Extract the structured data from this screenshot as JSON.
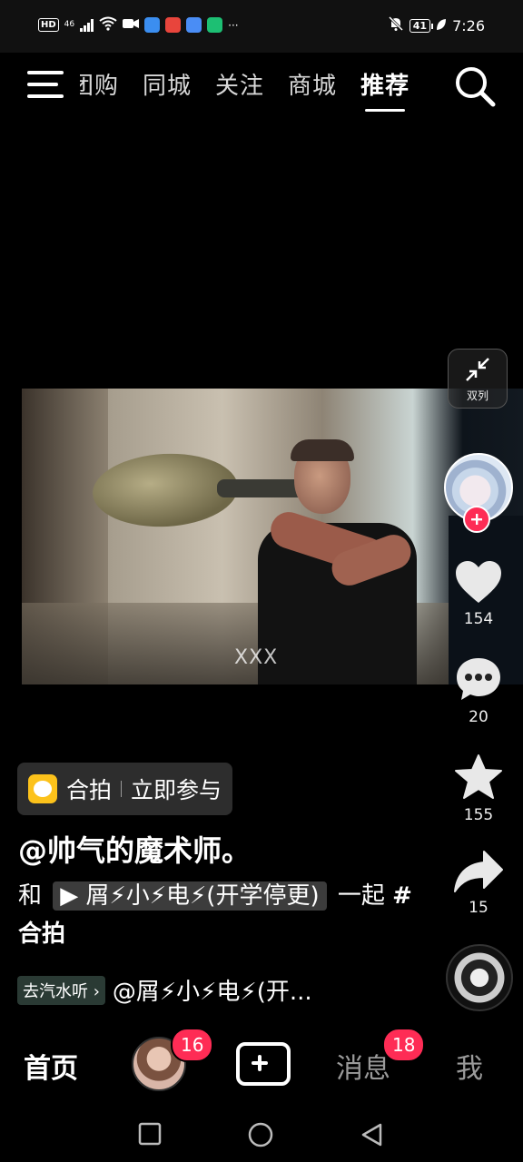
{
  "status_bar": {
    "hd": "HD",
    "network": "46",
    "time": "7:26",
    "battery": "41"
  },
  "top_nav": {
    "tabs": [
      {
        "label": "团购"
      },
      {
        "label": "同城"
      },
      {
        "label": "关注"
      },
      {
        "label": "商城"
      },
      {
        "label": "推荐"
      }
    ],
    "active_tab": "推荐"
  },
  "video": {
    "watermark": "XXX"
  },
  "sidebar": {
    "double_column_label": "双列",
    "likes": "154",
    "comments": "20",
    "favorites": "155",
    "shares": "15"
  },
  "content": {
    "duet_label": "合拍",
    "duet_action": "立即参与",
    "author": "@帅气的魔术师。",
    "desc_prefix": "和",
    "mention": "▶ 屑⚡小⚡电⚡(开学停更)",
    "desc_middle": "一起",
    "hashtag": "#合拍",
    "listen_chip": "去汽水听",
    "music_text": "@屑⚡小⚡电⚡(开..."
  },
  "bottom_nav": {
    "home": "首页",
    "friend_badge": "16",
    "messages": "消息",
    "messages_badge": "18",
    "me": "我"
  },
  "colors": {
    "accent": "#fe2c55",
    "duet_icon": "#fcc21b",
    "background": "#000000"
  }
}
